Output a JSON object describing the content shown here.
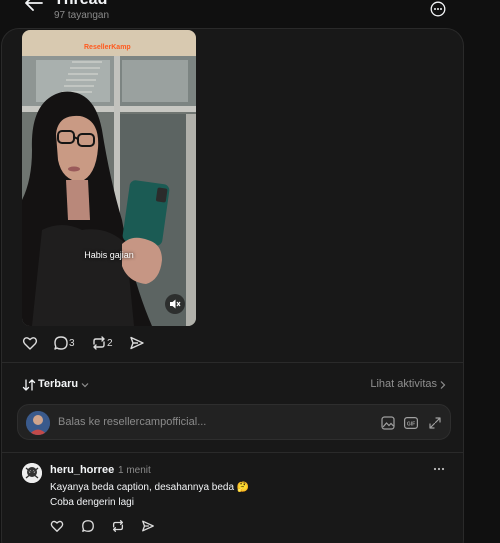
{
  "header": {
    "title": "Thread",
    "views": "97 tayangan"
  },
  "post": {
    "watermark": "ResellerKamp",
    "video_caption": "Habis gajian",
    "reply_count": "3",
    "repost_count": "2"
  },
  "sort": {
    "label": "Terbaru",
    "activity_link": "Lihat aktivitas"
  },
  "reply_box": {
    "placeholder": "Balas ke resellercampofficial..."
  },
  "comments": [
    {
      "username": "heru_horree",
      "time": "1 menit",
      "line1": "Kayanya beda caption, desahannya beda 🤔",
      "line2": "Coba dengerin lagi"
    }
  ]
}
